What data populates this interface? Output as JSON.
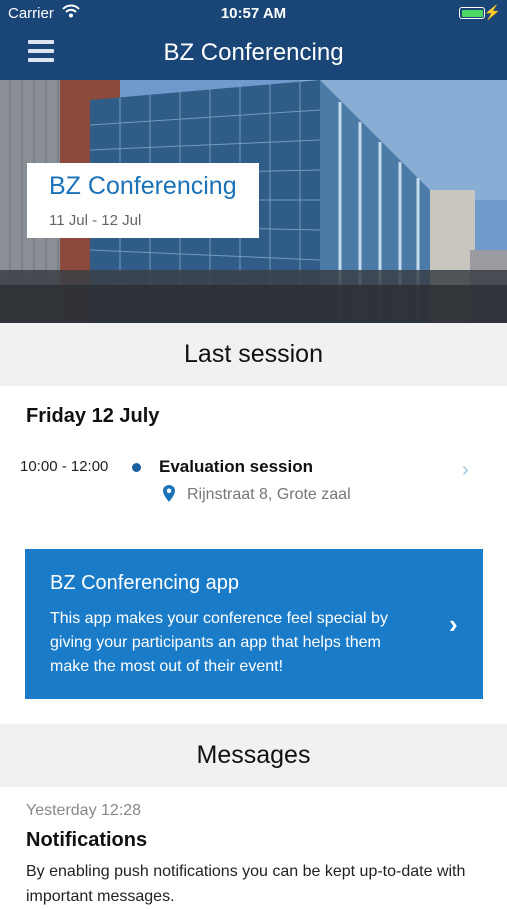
{
  "status_bar": {
    "carrier": "Carrier",
    "time": "10:57 AM"
  },
  "nav": {
    "title": "BZ Conferencing",
    "menu_icon": "hamburger-icon"
  },
  "hero": {
    "event_name": "BZ Conferencing",
    "dates": "11 Jul - 12 Jul"
  },
  "last_session": {
    "header": "Last session",
    "day": "Friday 12 July",
    "time": "10:00 - 12:00",
    "title": "Evaluation session",
    "location": "Rijnstraat 8, Grote zaal"
  },
  "promo": {
    "title": "BZ Conferencing app",
    "body": "This app makes your conference feel special by giving your participants an app that helps them make the most out of their event!"
  },
  "messages": {
    "header": "Messages",
    "timestamp": "Yesterday 12:28",
    "title": "Notifications",
    "body": "By enabling push notifications you can be kept up-to-date with important messages."
  },
  "colors": {
    "nav_bg": "#1a4577",
    "accent": "#1a7cc9",
    "event_name": "#1a72b8"
  }
}
